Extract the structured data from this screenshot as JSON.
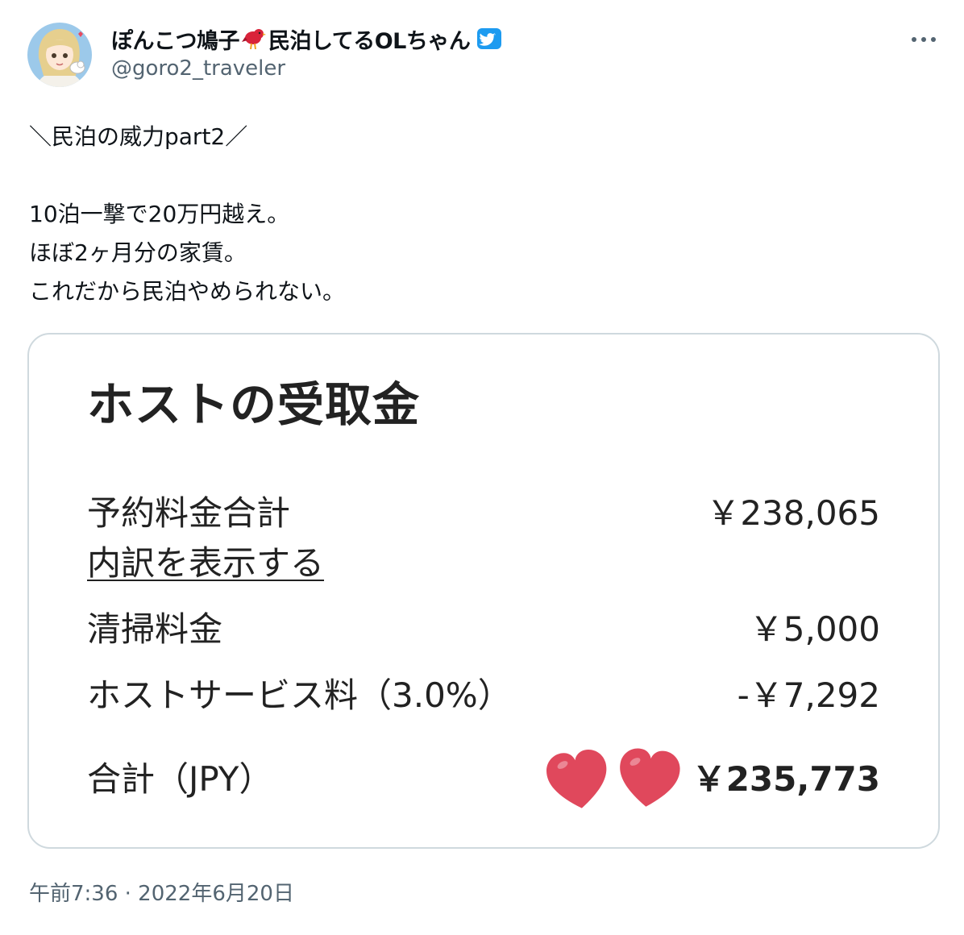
{
  "tweet": {
    "author": {
      "display_name_part1": "ぽんこつ鳩子",
      "display_name_part2": "民泊してるOLちゃん",
      "handle": "@goro2_traveler",
      "avatar_icon": "anime-girl-avatar-icon",
      "name_emoji": "red-bird-icon",
      "verified_icon": "twitter-bird-badge-icon"
    },
    "more_icon": "more-options-icon",
    "text_lines": [
      "＼民泊の威力part2／",
      "",
      "10泊一撃で20万円越え。",
      "ほぼ2ヶ月分の家賃。",
      "これだから民泊やめられない。"
    ],
    "timestamp": "午前7:36 · 2022年6月20日"
  },
  "media": {
    "title": "ホストの受取金",
    "rows": [
      {
        "label": "予約料金合計",
        "value": "￥238,065"
      },
      {
        "label": "内訳を表示する",
        "value": ""
      },
      {
        "label": "清掃料金",
        "value": "￥5,000"
      },
      {
        "label": "ホストサービス料（3.0%）",
        "value": "-￥7,292"
      },
      {
        "label": "合計（JPY）",
        "value": "￥235,773"
      }
    ],
    "heart_icon": "heart-emoji-icon",
    "heart_color": "#e0485c"
  },
  "colors": {
    "text_primary": "#0f1419",
    "text_secondary": "#536471",
    "border": "#cfd9de",
    "verified_blue": "#1d9bf0"
  }
}
